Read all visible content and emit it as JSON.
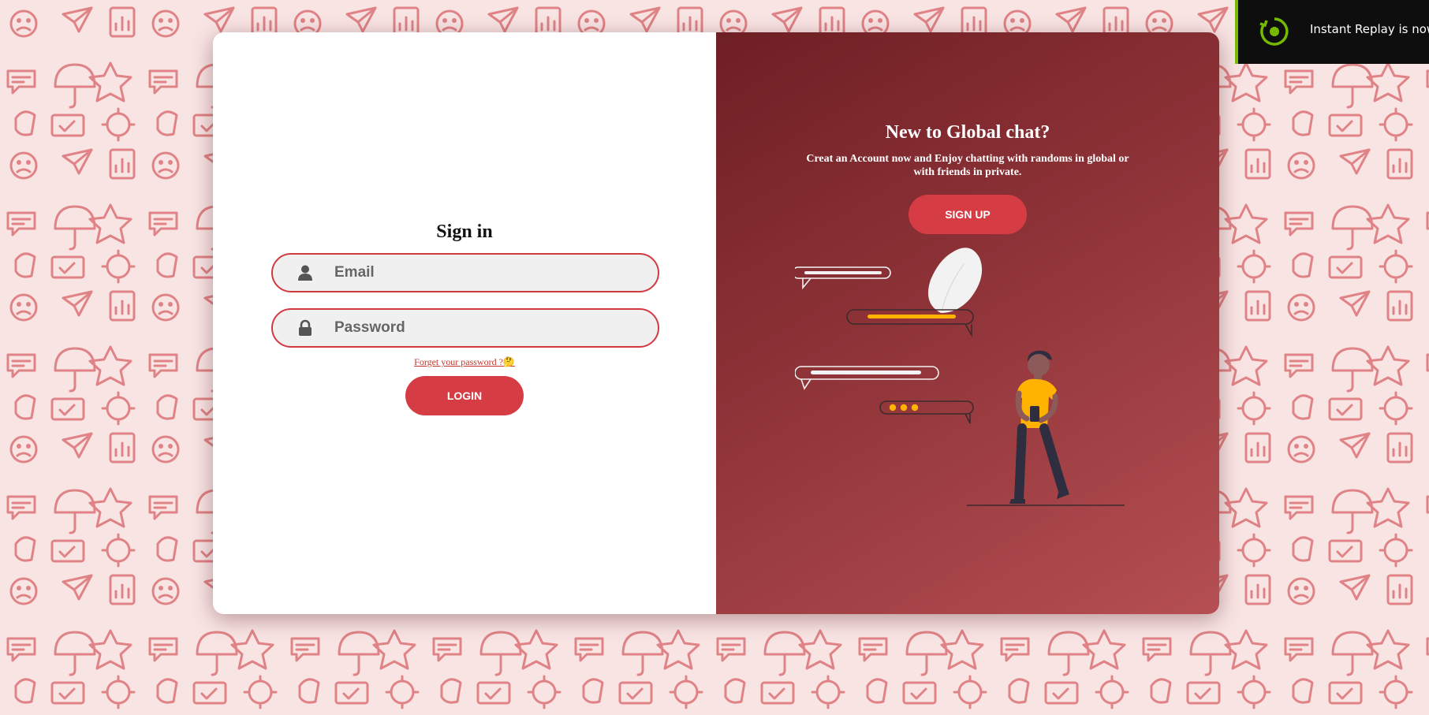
{
  "signin": {
    "title": "Sign in",
    "email_placeholder": "Email",
    "password_placeholder": "Password",
    "forgot_text": "Forget your password ?🤔",
    "login_label": "LOGIN"
  },
  "signup_panel": {
    "title": "New to Global chat?",
    "description": "Creat an Account now and Enjoy chatting with randoms in global or with friends in private.",
    "signup_label": "SIGN UP"
  },
  "toast": {
    "text": "Instant Replay is now on",
    "icon": "instant-replay-icon"
  },
  "colors": {
    "accent": "#d63c44",
    "panel_dark": "#6e1f24",
    "panel_light": "#b54f53",
    "background": "#f8dede",
    "toast_accent": "#76b900",
    "illustration_yellow": "#ffb300"
  }
}
